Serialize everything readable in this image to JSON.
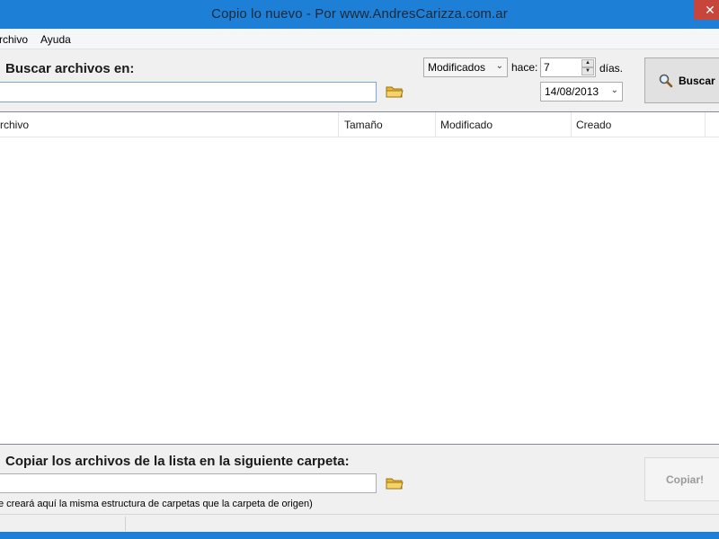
{
  "window": {
    "title": "Copio lo nuevo - Por www.AndresCarizza.com.ar",
    "close_glyph": "✕"
  },
  "menu": {
    "items": [
      "rchivo",
      "Ayuda"
    ]
  },
  "search": {
    "label": "Buscar archivos en:",
    "path_value": "",
    "filter_select": "Modificados",
    "hace_label": "hace:",
    "days_value": "7",
    "days_label": "días.",
    "date_value": "14/08/2013",
    "search_button": "Buscar",
    "search_button_icon": "magnifier-icon"
  },
  "list": {
    "columns": [
      "rchivo",
      "Tamaño",
      "Modificado",
      "Creado"
    ],
    "rows": []
  },
  "copy": {
    "label": "Copiar los archivos de la lista en la siguiente carpeta:",
    "path_value": "",
    "note": "e creará aquí la misma estructura de carpetas que la carpeta de origen)",
    "copy_button": "Copiar!"
  },
  "colors": {
    "title_bar": "#1e7fd6",
    "close_button": "#c7463b",
    "field_border": "#7aa7d9",
    "folder_icon": "#e8b930"
  }
}
